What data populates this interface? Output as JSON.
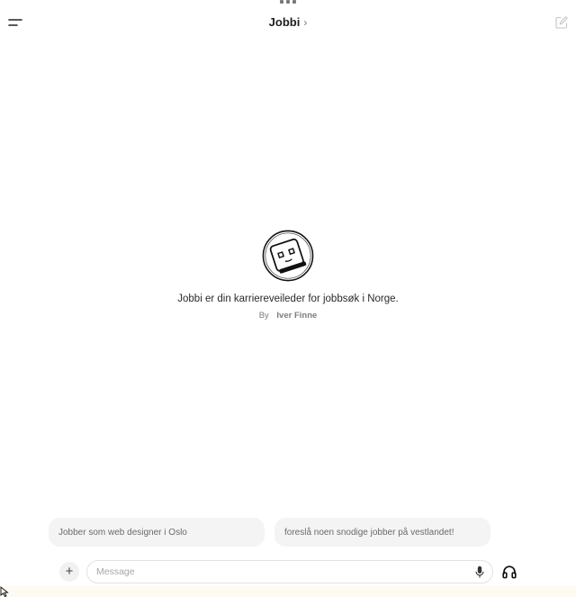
{
  "header": {
    "title": "Jobbi",
    "title_chevron": "›"
  },
  "gpt": {
    "description": "Jobbi er din karriereveileder for jobbsøk i Norge.",
    "by_label": "By",
    "author": "Iver Finne"
  },
  "suggestions": [
    {
      "label": "Jobber som web designer i Oslo"
    },
    {
      "label": "foreslå noen snodige jobber på vestlandet!"
    }
  ],
  "composer": {
    "placeholder": "Message",
    "value": "",
    "plus_label": "+"
  },
  "icons": {
    "menu": "menu-icon",
    "new_chat": "edit-icon",
    "mic": "microphone-icon",
    "voice": "headphones-icon",
    "avatar": "robot-avatar"
  }
}
